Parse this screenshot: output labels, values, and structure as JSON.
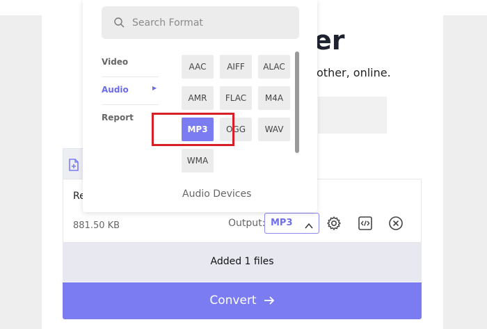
{
  "background": {
    "heading_fragment": "er",
    "subtitle_fragment": "other, online."
  },
  "format_panel": {
    "search_placeholder": "Search Format",
    "categories": [
      {
        "label": "Video",
        "active": false
      },
      {
        "label": "Audio",
        "active": true
      },
      {
        "label": "Report",
        "active": false
      }
    ],
    "formats": [
      "AAC",
      "AIFF",
      "ALAC",
      "AMR",
      "FLAC",
      "M4A",
      "MP3",
      "OGG",
      "WAV",
      "WMA"
    ],
    "selected_format": "MP3",
    "devices_label": "Audio Devices"
  },
  "file": {
    "name_fragment": "Re",
    "size": "881.50 KB",
    "output_label": "Output:",
    "output_value": "MP3",
    "status": "Added 1 files",
    "convert_label": "Convert"
  },
  "colors": {
    "accent": "#7b7bf2",
    "highlight": "#d61f26"
  }
}
